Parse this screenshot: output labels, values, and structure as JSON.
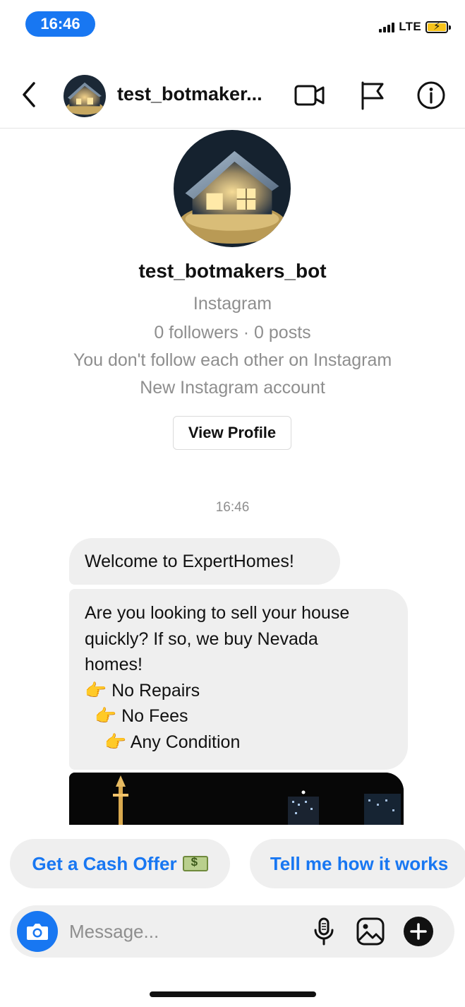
{
  "status_bar": {
    "time": "16:46",
    "network": "LTE"
  },
  "header": {
    "title": "test_botmaker..."
  },
  "profile": {
    "name": "test_botmakers_bot",
    "platform": "Instagram",
    "stats": "0 followers · 0 posts",
    "follow_status": "You don't follow each other on Instagram",
    "account_note": "New Instagram account",
    "view_profile_label": "View Profile"
  },
  "conversation": {
    "timestamp": "16:46",
    "messages": [
      {
        "text": "Welcome to ExpertHomes!"
      },
      {
        "lines": [
          "Are you looking to sell your house",
          "quickly? If so, we buy Nevada",
          "homes!",
          "👉 No Repairs",
          "👉 No Fees",
          "👉 Any Condition"
        ]
      }
    ]
  },
  "quick_replies": [
    {
      "label": "Get a Cash Offer",
      "icon": "money-icon"
    },
    {
      "label": "Tell me how it works"
    }
  ],
  "composer": {
    "placeholder": "Message..."
  },
  "colors": {
    "accent": "#1877f2",
    "bubble": "#efefef",
    "muted": "#8e8e8e"
  }
}
